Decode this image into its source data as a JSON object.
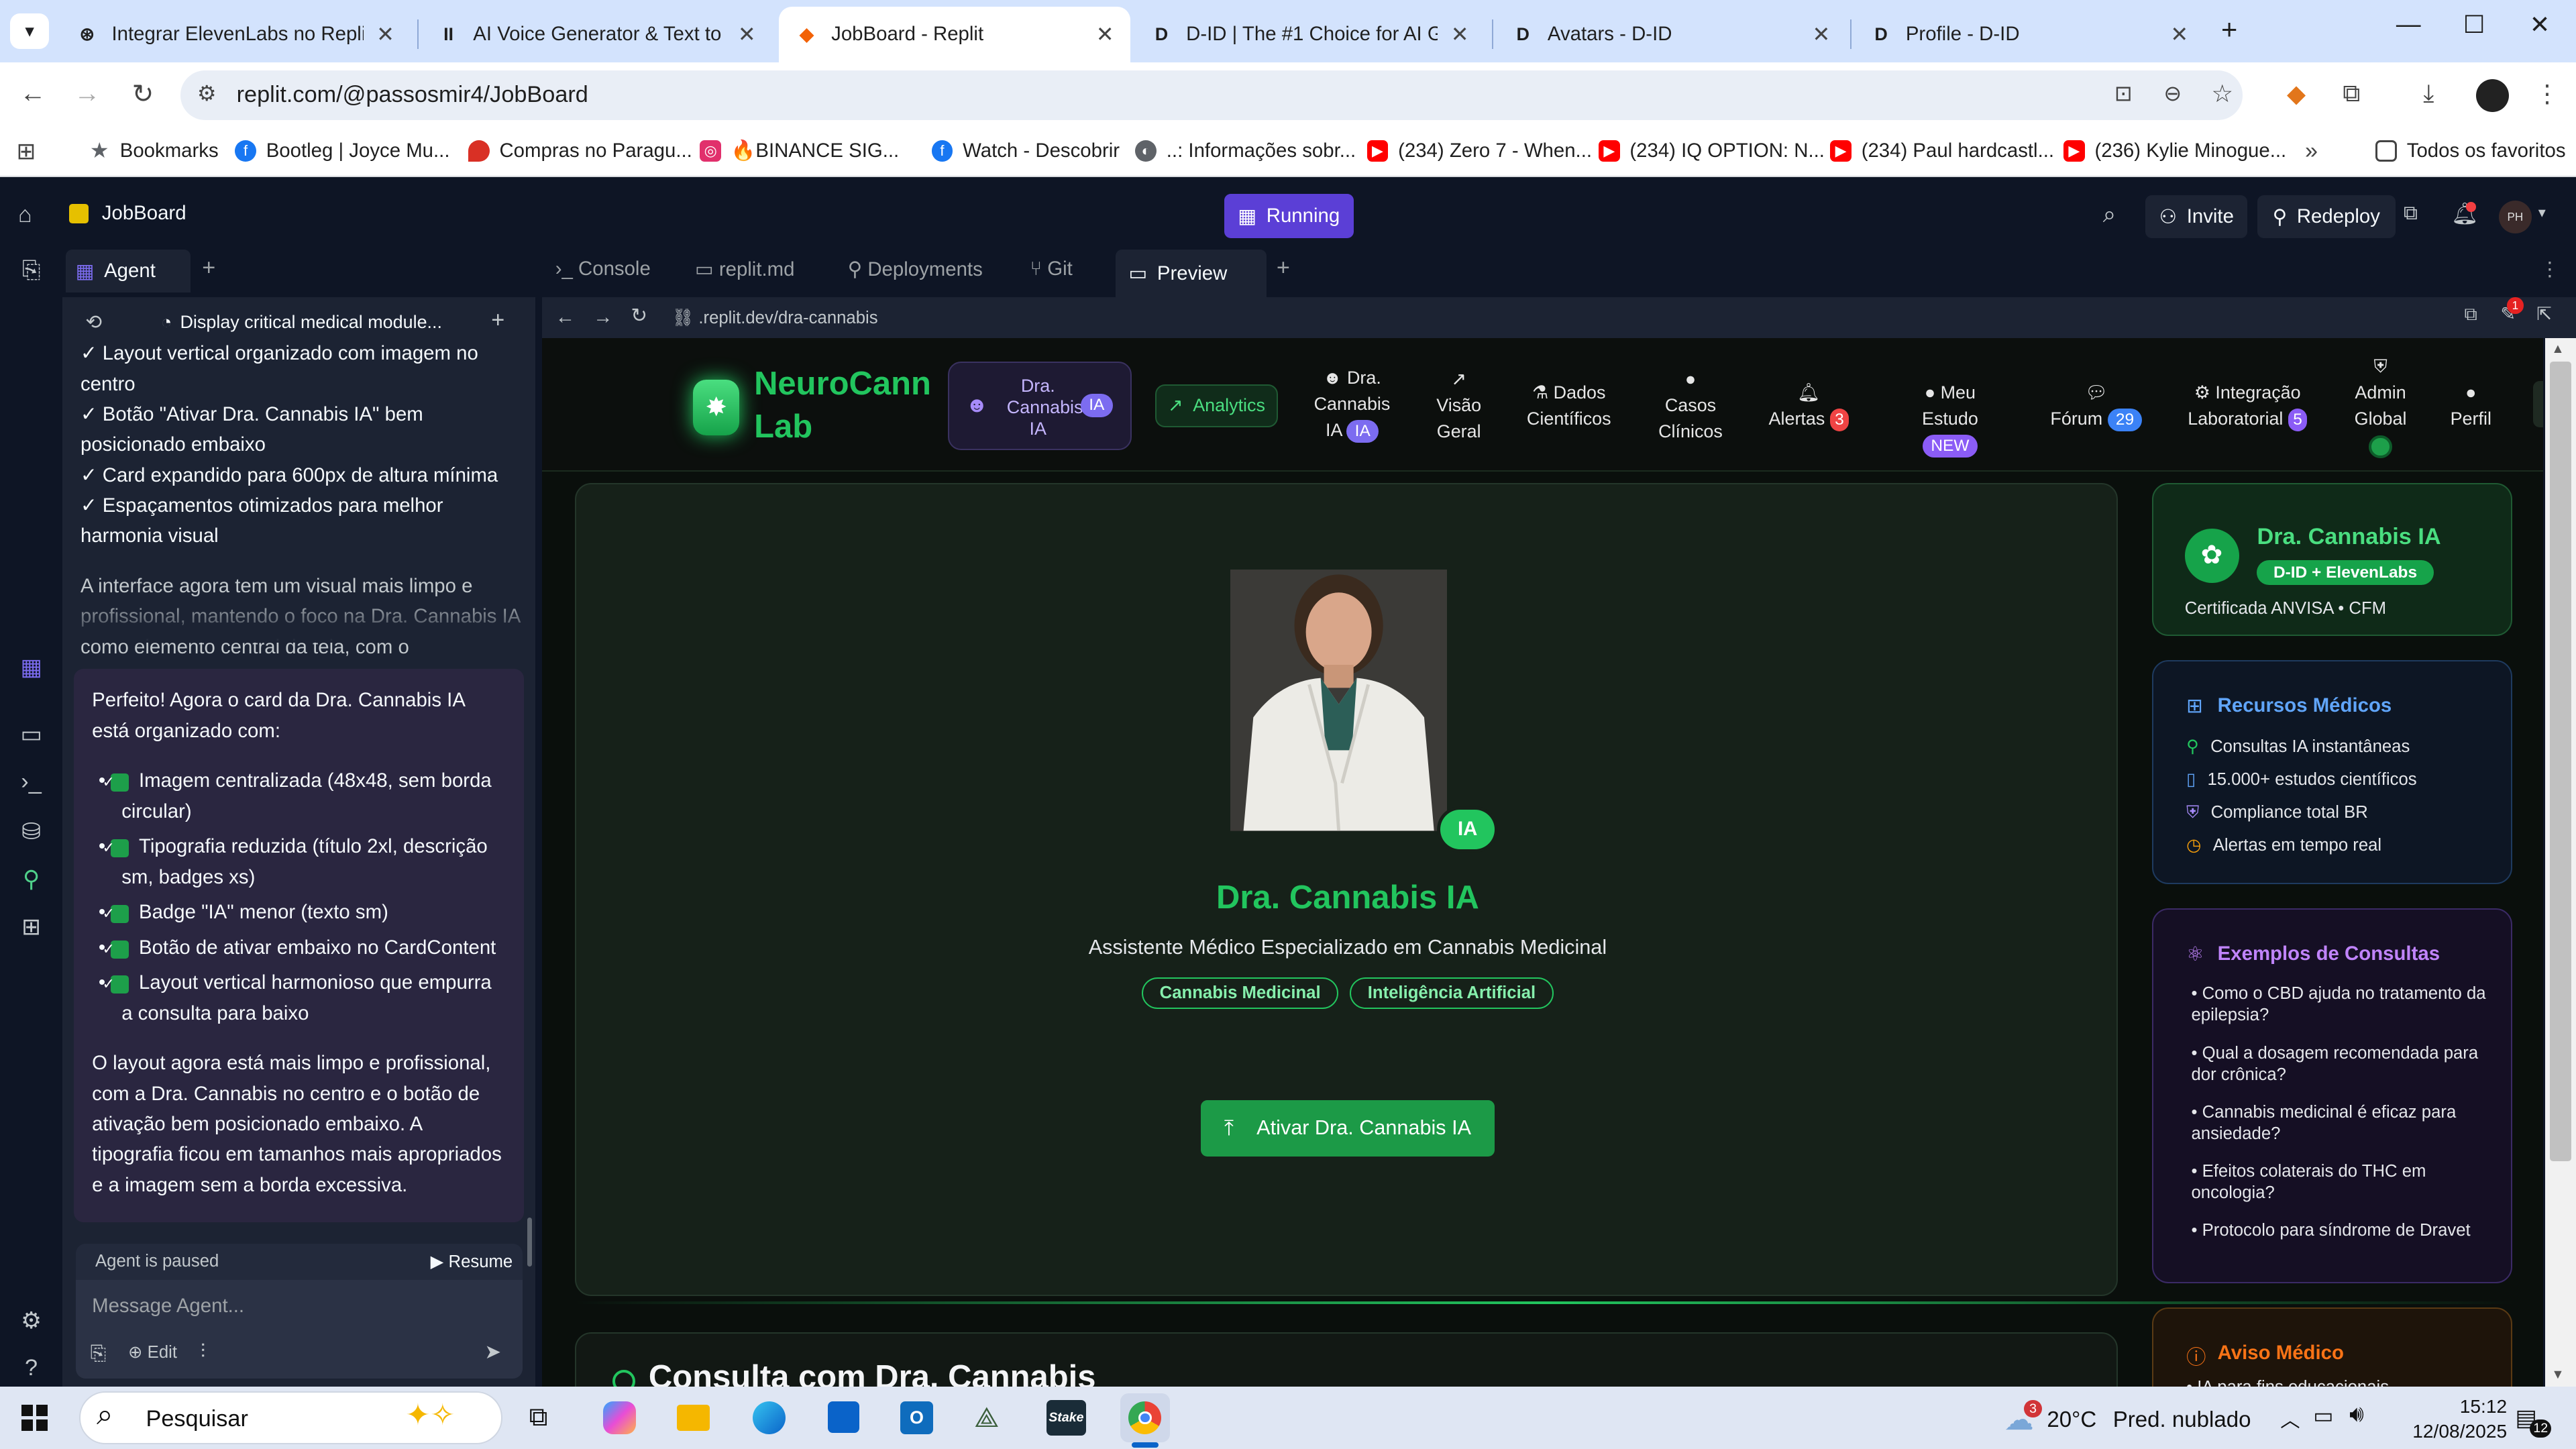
{
  "browser": {
    "tabs": [
      {
        "title": "Integrar ElevenLabs no Replit",
        "icon": "ai-chat-icon"
      },
      {
        "title": "AI Voice Generator & Text to Sp",
        "icon": "elevenlabs-icon"
      },
      {
        "title": "JobBoard - Replit",
        "icon": "replit-icon",
        "active": true
      },
      {
        "title": "D-ID | The #1 Choice for AI Gen",
        "icon": "did-icon"
      },
      {
        "title": "Avatars - D-ID",
        "icon": "did-icon"
      },
      {
        "title": "Profile - D-ID",
        "icon": "did-icon"
      }
    ],
    "url": "replit.com/@passosmir4/JobBoard",
    "bookmarks": [
      {
        "label": "Bookmarks",
        "icon": "star-icon",
        "color": "#5f6368"
      },
      {
        "label": "Bootleg | Joyce Mu...",
        "icon": "facebook-icon",
        "color": "#1877f2"
      },
      {
        "label": "Compras no Paragu...",
        "icon": "pin-icon",
        "color": "#d93025"
      },
      {
        "label": "🔥BINANCE SIG...",
        "icon": "instagram-icon",
        "color": "#e1306c"
      },
      {
        "label": "Watch - Descobrir",
        "icon": "facebook-icon",
        "color": "#1877f2"
      },
      {
        "label": "..: Informações sobr...",
        "icon": "globe-icon",
        "color": "#5f6368"
      },
      {
        "label": "(234) Zero 7 - When...",
        "icon": "youtube-icon",
        "color": "#ff0000"
      },
      {
        "label": "(234) IQ OPTION: N...",
        "icon": "youtube-icon",
        "color": "#ff0000"
      },
      {
        "label": "(234) Paul hardcastl...",
        "icon": "youtube-icon",
        "color": "#ff0000"
      },
      {
        "label": "(236) Kylie Minogue...",
        "icon": "youtube-icon",
        "color": "#ff0000"
      }
    ],
    "all_bookmarks": "Todos os favoritos"
  },
  "replit": {
    "project": "JobBoard",
    "status": "Running",
    "invite": "Invite",
    "redeploy": "Redeploy",
    "avatar": "PH",
    "agent_tab": "Agent",
    "agent_task": "Display critical medical module...",
    "workspace_tabs": [
      "Console",
      "replit.md",
      "Deployments",
      "Git",
      "Preview"
    ],
    "preview_url": ".replit.dev/dra-cannabis",
    "notif_count": "1"
  },
  "agent": {
    "earlier_items": [
      "✓ Layout vertical organizado com imagem no centro",
      "✓ Botão \"Ativar Dra. Cannabis IA\" bem posicionado embaixo",
      "✓ Card expandido para 600px de altura mínima",
      "✓ Espaçamentos otimizados para melhor harmonia visual"
    ],
    "earlier_summary": "A interface agora tem um visual mais limpo e profissional, mantendo o foco na Dra. Cannabis IA como elemento central da tela, com o",
    "message_intro": "Perfeito! Agora o card da Dra. Cannabis IA está organizado com:",
    "message_items": [
      "Imagem centralizada (48x48, sem borda circular)",
      "Tipografia reduzida (título 2xl, descrição sm, badges xs)",
      "Badge \"IA\" menor (texto sm)",
      "Botão de ativar embaixo no CardContent",
      "Layout vertical harmonioso que empurra a consulta para baixo"
    ],
    "message_outro": "O layout agora está mais limpo e profissional, com a Dra. Cannabis no centro e o botão de ativação bem posicionado embaixo. A tipografia ficou em tamanhos mais apropriados e a imagem sem a borda excessiva.",
    "paused": "Agent is paused",
    "resume": "Resume",
    "input_placeholder": "Message Agent...",
    "edit": "Edit"
  },
  "site": {
    "brand_line1": "NeuroCann",
    "brand_line2": "Lab",
    "nav": {
      "dra": {
        "l1": "Dra.",
        "l2": "Cannabis",
        "l3": "IA",
        "badge": "IA"
      },
      "analytics": "Analytics",
      "dra2": {
        "l1": "Dra.",
        "l2": "Cannabis",
        "l3": "IA",
        "badge": "IA"
      },
      "visao": {
        "l1": "Visão",
        "l2": "Geral"
      },
      "dados": {
        "l1": "Dados",
        "l2": "Científicos"
      },
      "casos": {
        "l1": "Casos",
        "l2": "Clínicos"
      },
      "alertas": {
        "label": "Alertas",
        "badge": "3"
      },
      "estudo": {
        "l1": "Meu",
        "l2": "Estudo",
        "badge": "NEW"
      },
      "forum": {
        "label": "Fórum",
        "badge": "29"
      },
      "integracao": {
        "l1": "Integração",
        "l2": "Laboratorial",
        "badge": "5"
      },
      "admin": {
        "l1": "Admin",
        "l2": "Global"
      },
      "perfil": "Perfil"
    },
    "hero": {
      "ia_badge": "IA",
      "name": "Dra. Cannabis IA",
      "subtitle": "Assistente Médico Especializado em Cannabis Medicinal",
      "tags": [
        "Cannabis Medicinal",
        "Inteligência Artificial"
      ],
      "button": "Ativar Dra. Cannabis IA"
    },
    "side_card": {
      "title": "Dra. Cannabis IA",
      "pill": "D-ID + ElevenLabs",
      "cert": "Certificada ANVISA • CFM"
    },
    "recursos": {
      "title": "Recursos Médicos",
      "items": [
        {
          "text": "Consultas IA instantâneas",
          "icon": "stethoscope-icon",
          "color": "#22c55e"
        },
        {
          "text": "15.000+ estudos científicos",
          "icon": "book-icon",
          "color": "#60a5fa"
        },
        {
          "text": "Compliance total BR",
          "icon": "shield-icon",
          "color": "#a78bfa"
        },
        {
          "text": "Alertas em tempo real",
          "icon": "alert-icon",
          "color": "#f59e0b"
        }
      ]
    },
    "exemplos": {
      "title": "Exemplos de Consultas",
      "items": [
        "• Como o CBD ajuda no tratamento da epilepsia?",
        "• Qual a dosagem recomendada para dor crônica?",
        "• Cannabis medicinal é eficaz para ansiedade?",
        "• Efeitos colaterais do THC em oncologia?",
        "• Protocolo para síndrome de Dravet"
      ]
    },
    "aviso": {
      "title": "Aviso Médico",
      "text": "• IA para fins educacionais"
    },
    "consulta_title": "Consulta com Dra. Cannabis"
  },
  "taskbar": {
    "search": "Pesquisar",
    "weather_temp": "20°C",
    "weather_desc": "Pred. nublado",
    "weather_badge": "3",
    "time": "15:12",
    "date": "12/08/2025",
    "notif": "12"
  },
  "colors": {
    "accent_green": "#22c55e",
    "replit_purple": "#5b3fd6",
    "site_bg": "#0a0f0c"
  }
}
